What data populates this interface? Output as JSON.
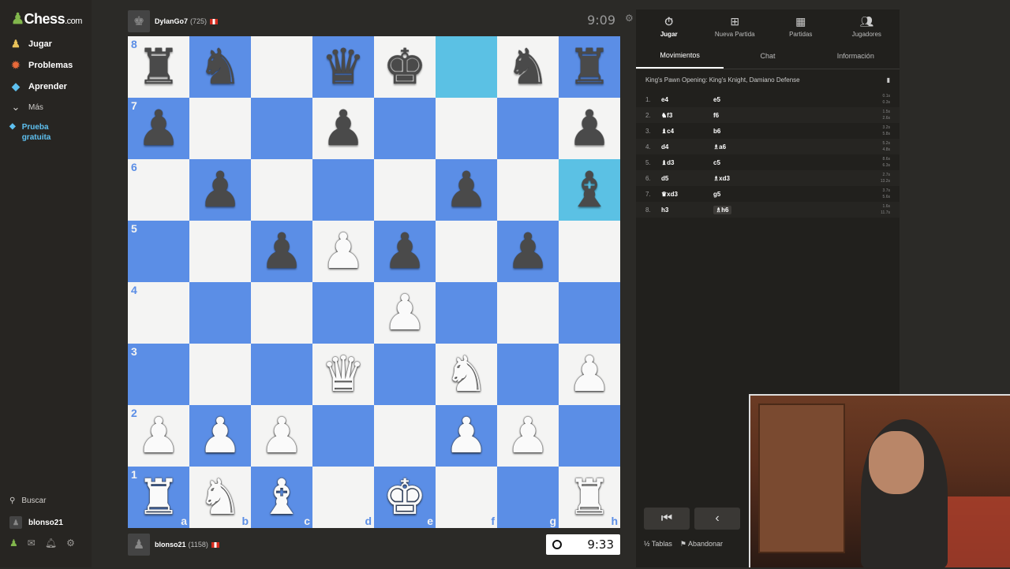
{
  "sidebar": {
    "logo_main": "Chess",
    "logo_tld": ".com",
    "items": [
      {
        "label": "Jugar",
        "icon": "play-icon"
      },
      {
        "label": "Problemas",
        "icon": "puzzle-icon"
      },
      {
        "label": "Aprender",
        "icon": "learn-icon"
      },
      {
        "label": "Más",
        "icon": "chevron-down-icon"
      }
    ],
    "trial_label": "Prueba gratuita",
    "search_label": "Buscar",
    "user_label": "blonso21"
  },
  "top_player": {
    "name": "DylanGo7",
    "rating": "(725)",
    "clock": "9:09"
  },
  "bottom_player": {
    "name": "blonso21",
    "rating": "(1158)",
    "clock": "9:33"
  },
  "board": {
    "ranks": [
      "8",
      "7",
      "6",
      "5",
      "4",
      "3",
      "2",
      "1"
    ],
    "files": [
      "a",
      "b",
      "c",
      "d",
      "e",
      "f",
      "g",
      "h"
    ],
    "rows": [
      [
        "br",
        "bn",
        "",
        "bq",
        "bk",
        "",
        "bn",
        "br"
      ],
      [
        "bp",
        "",
        "",
        "bp",
        "",
        "",
        "",
        "bp"
      ],
      [
        "",
        "bp",
        "",
        "",
        "",
        "bp",
        "",
        "bb"
      ],
      [
        "",
        "",
        "bp",
        "wp",
        "bp",
        "",
        "bp",
        ""
      ],
      [
        "",
        "",
        "",
        "",
        "wp",
        "",
        "",
        ""
      ],
      [
        "",
        "",
        "",
        "wq",
        "",
        "wn",
        "",
        "wp"
      ],
      [
        "wp",
        "wp",
        "wp",
        "",
        "",
        "wp",
        "wp",
        ""
      ],
      [
        "wr",
        "wn",
        "wb",
        "",
        "wk",
        "",
        "",
        "wr"
      ]
    ],
    "highlights": [
      "f8",
      "h6"
    ]
  },
  "panel": {
    "tabs": [
      {
        "label": "Jugar",
        "icon": "clock-icon"
      },
      {
        "label": "Nueva Partida",
        "icon": "plus-icon"
      },
      {
        "label": "Partidas",
        "icon": "board-icon"
      },
      {
        "label": "Jugadores",
        "icon": "players-icon"
      }
    ],
    "subtabs": [
      "Movimientos",
      "Chat",
      "Información"
    ],
    "opening": "King's Pawn Opening: King's Knight, Damiano Defense",
    "moves": [
      {
        "n": "1.",
        "w": "e4",
        "b": "e5",
        "t": [
          "0.1s",
          "0.3s"
        ]
      },
      {
        "n": "2.",
        "w": "♞f3",
        "b": "f6",
        "t": [
          "1.5s",
          "2.6s"
        ]
      },
      {
        "n": "3.",
        "w": "♝c4",
        "b": "b6",
        "t": [
          "3.2s",
          "5.8s"
        ]
      },
      {
        "n": "4.",
        "w": "d4",
        "b": "♗a6",
        "t": [
          "5.2s",
          "4.8s"
        ]
      },
      {
        "n": "5.",
        "w": "♝d3",
        "b": "c5",
        "t": [
          "8.6s",
          "6.3s"
        ]
      },
      {
        "n": "6.",
        "w": "d5",
        "b": "♗xd3",
        "t": [
          "2.7s",
          "13.2s"
        ]
      },
      {
        "n": "7.",
        "w": "♛xd3",
        "b": "g5",
        "t": [
          "3.7s",
          "5.6s"
        ]
      },
      {
        "n": "8.",
        "w": "h3",
        "b": "♗h6",
        "t": [
          "1.6s",
          "11.7s"
        ]
      }
    ],
    "footer": {
      "draw": "Tablas",
      "resign": "Abandonar"
    }
  }
}
